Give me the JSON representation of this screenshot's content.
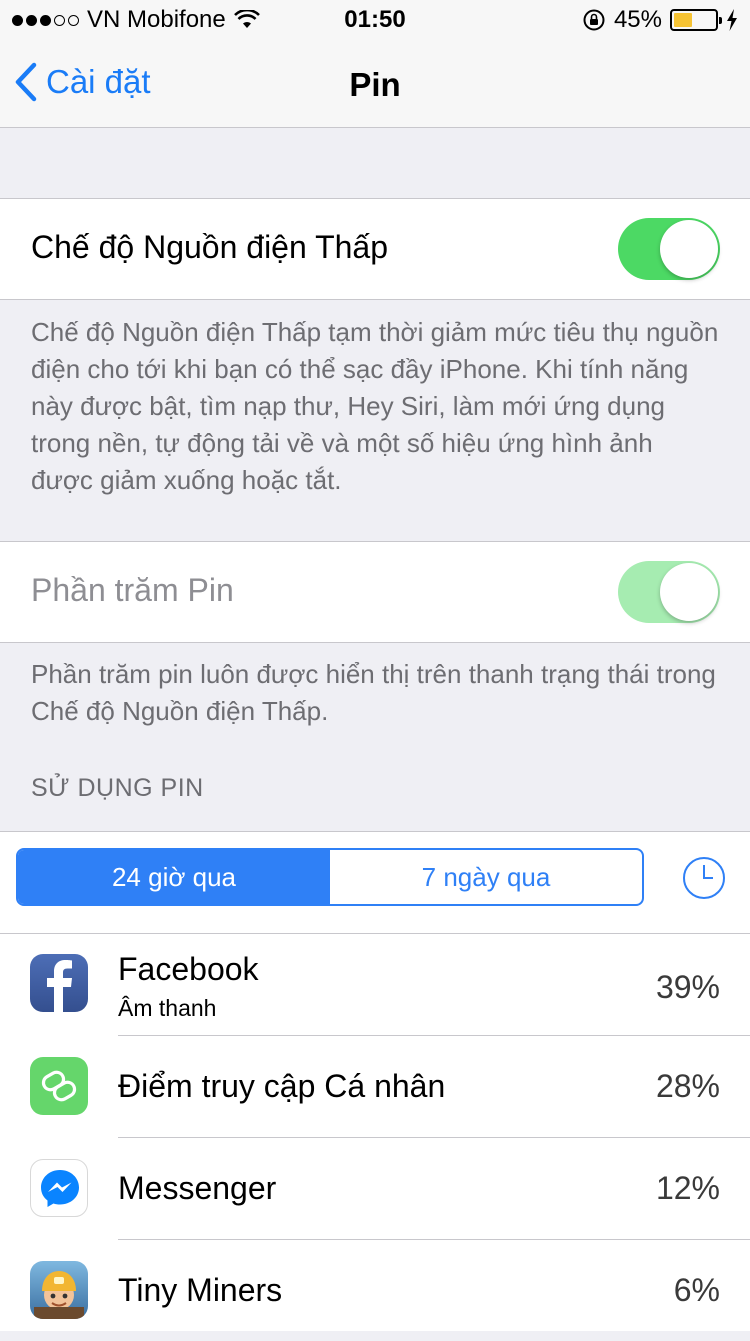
{
  "status": {
    "carrier": "VN Mobifone",
    "time": "01:50",
    "battery_percent": "45%",
    "battery_level": 0.45,
    "signal_dots_filled": 3,
    "signal_dots_total": 5
  },
  "nav": {
    "back_label": "Cài đặt",
    "title": "Pin"
  },
  "low_power": {
    "label": "Chế độ Nguồn điện Thấp",
    "on": true,
    "description": "Chế độ Nguồn điện Thấp tạm thời giảm mức tiêu thụ nguồn điện cho tới khi bạn có thể sạc đầy iPhone. Khi tính năng này được bật, tìm nạp thư, Hey Siri, làm mới ứng dụng trong nền, tự động tải về và một số hiệu ứng hình ảnh được giảm xuống hoặc tắt."
  },
  "battery_percentage": {
    "label": "Phần trăm Pin",
    "on": true,
    "enabled": false,
    "description": "Phần trăm pin luôn được hiển thị trên thanh trạng thái trong Chế độ Nguồn điện Thấp."
  },
  "usage": {
    "header": "SỬ DỤNG PIN",
    "tabs": [
      {
        "label": "24 giờ qua",
        "selected": true
      },
      {
        "label": "7 ngày qua",
        "selected": false
      }
    ],
    "apps": [
      {
        "name": "Facebook",
        "subtitle": "Âm thanh",
        "percent": "39%",
        "icon": "facebook-icon"
      },
      {
        "name": "Điểm truy cập Cá nhân",
        "subtitle": "",
        "percent": "28%",
        "icon": "hotspot-icon"
      },
      {
        "name": "Messenger",
        "subtitle": "",
        "percent": "12%",
        "icon": "messenger-icon"
      },
      {
        "name": "Tiny Miners",
        "subtitle": "",
        "percent": "6%",
        "icon": "tiny-miners-icon"
      }
    ]
  },
  "colors": {
    "accent": "#2f80f6",
    "toggle_on": "#4cd964",
    "toggle_disabled": "#a6ecb1",
    "battery_fill": "#f6c333"
  }
}
